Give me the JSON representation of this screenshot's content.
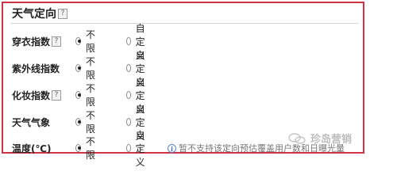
{
  "section": {
    "title": "天气定向",
    "title_help": "?"
  },
  "rows": [
    {
      "label": "穿衣指数",
      "help": "?",
      "opt1": "不限",
      "opt2": "自定义"
    },
    {
      "label": "紫外线指数",
      "opt1": "不限",
      "opt2": "自定义"
    },
    {
      "label": "化妆指数",
      "help": "?",
      "opt1": "不限",
      "opt2": "自定义"
    },
    {
      "label": "天气气象",
      "opt1": "不限",
      "opt2": "自定义"
    },
    {
      "label": "温度(℃)",
      "opt1": "不限",
      "opt2": "自定义",
      "note": "暂不支持该定向预估覆盖用户数和日曝光量"
    }
  ],
  "info_icon_glyph": "i",
  "watermark": {
    "text": "珍岛营销"
  }
}
